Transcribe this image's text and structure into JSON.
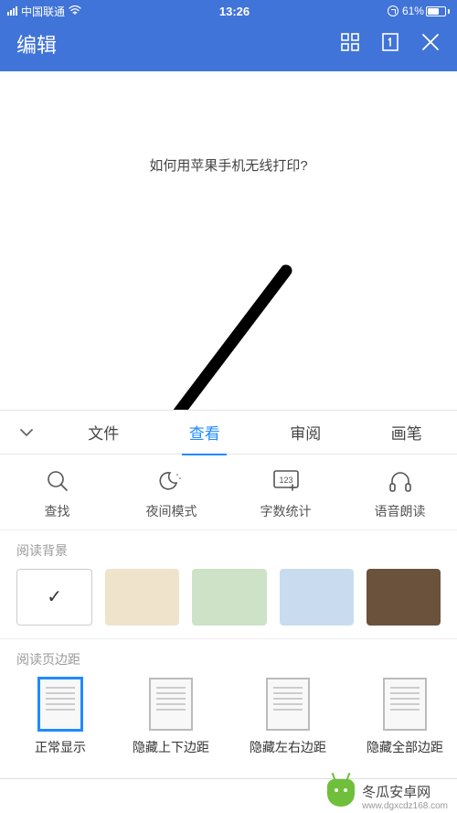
{
  "status": {
    "carrier": "中国联通",
    "time": "13:26",
    "battery_pct": "61%"
  },
  "header": {
    "title": "编辑"
  },
  "document": {
    "title_text": "如何用苹果手机无线打印?"
  },
  "tabs": {
    "items": [
      "文件",
      "查看",
      "审阅",
      "画笔"
    ],
    "active_index": 1
  },
  "tools": {
    "items": [
      {
        "label": "查找",
        "icon": "search-icon"
      },
      {
        "label": "夜间模式",
        "icon": "moon-icon"
      },
      {
        "label": "字数统计",
        "icon": "wordcount-icon"
      },
      {
        "label": "语音朗读",
        "icon": "headphones-icon"
      }
    ]
  },
  "background_section": {
    "title": "阅读背景",
    "swatches": [
      "#ffffff",
      "#f0e3cc",
      "#cde2c7",
      "#c9dcef",
      "#6b523c"
    ],
    "selected_index": 0
  },
  "margin_section": {
    "title": "阅读页边距",
    "options": [
      "正常显示",
      "隐藏上下边距",
      "隐藏左右边距",
      "隐藏全部边距"
    ],
    "selected_index": 0
  },
  "watermark": {
    "brand": "冬瓜安卓网",
    "url": "www.dgxcdz168.com"
  }
}
